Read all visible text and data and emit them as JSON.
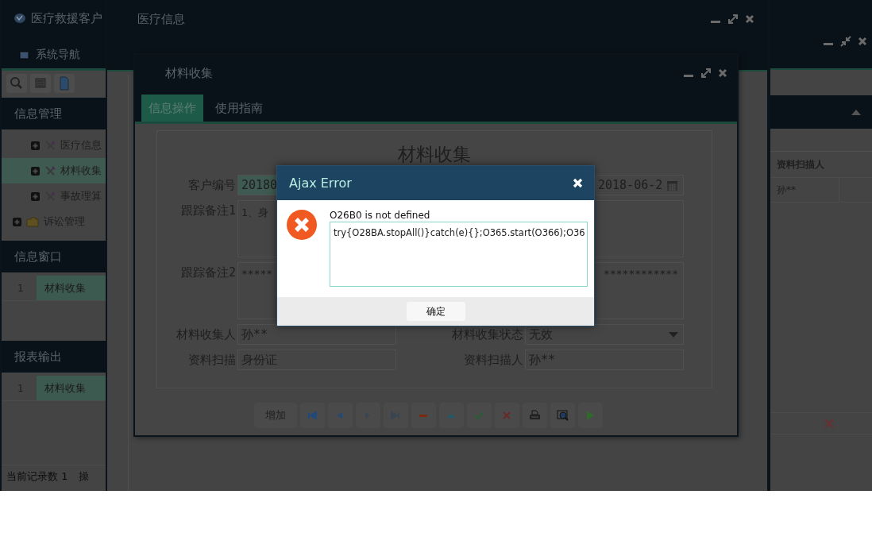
{
  "main_window": {
    "title": "医疗救援客户",
    "tabs": [
      {
        "label": "系统导航",
        "selected": false
      }
    ],
    "sections": [
      {
        "title": "信息管理",
        "tree": [
          {
            "label": "医疗信息",
            "kind": "module",
            "expanded": false,
            "selected": false
          },
          {
            "label": "材料收集",
            "kind": "module",
            "expanded": false,
            "selected": true
          },
          {
            "label": "事故理算",
            "kind": "module",
            "expanded": false,
            "selected": false
          }
        ],
        "folders": [
          {
            "label": "诉讼管理",
            "kind": "folder",
            "expanded": false,
            "selected": false
          }
        ]
      },
      {
        "title": "信息窗口",
        "rows": [
          {
            "index": "1",
            "label": "材料收集"
          }
        ]
      },
      {
        "title": "报表输出",
        "rows": [
          {
            "index": "1",
            "label": "材料收集"
          }
        ]
      }
    ],
    "status_bar": {
      "record_count": "当前记录数 1",
      "operation": "操"
    },
    "grid": {
      "columns": [
        "资料扫描人"
      ],
      "rows": [
        [
          "孙**"
        ]
      ]
    }
  },
  "info_window": {
    "title": "医疗信息"
  },
  "form_window": {
    "title": "材料收集",
    "tabs": [
      {
        "label": "信息操作",
        "selected": true
      },
      {
        "label": "使用指南",
        "selected": false
      }
    ],
    "form": {
      "heading": "材料收集",
      "rows": [
        {
          "cells": [
            {
              "label": "客户编号",
              "value": "20180",
              "kind": "text"
            },
            {
              "value": "2018-06-2",
              "kind": "date"
            }
          ]
        },
        {
          "cells": [
            {
              "label": "跟踪备注1",
              "value": "1、身",
              "kind": "textarea"
            }
          ]
        },
        {
          "cells": [
            {
              "label": "跟踪备注2",
              "value": "*****",
              "value_right": "************",
              "kind": "textarea"
            }
          ]
        },
        {
          "cells": [
            {
              "label": "材料收集人",
              "value": "孙**",
              "kind": "text"
            },
            {
              "label": "材料收集状态",
              "value": "无效",
              "kind": "select"
            }
          ]
        },
        {
          "cells": [
            {
              "label": "资料扫描",
              "value": "身份证",
              "kind": "text"
            },
            {
              "label": "资料扫描人",
              "value": "孙**",
              "kind": "text"
            }
          ]
        }
      ]
    },
    "toolbar": {
      "add_label": "增加",
      "buttons": [
        {
          "kind": "first",
          "disabled": false
        },
        {
          "kind": "prev",
          "disabled": false
        },
        {
          "kind": "next",
          "disabled": true
        },
        {
          "kind": "last",
          "disabled": true
        },
        {
          "kind": "delete",
          "disabled": false
        },
        {
          "kind": "up",
          "disabled": false
        },
        {
          "kind": "save",
          "disabled": false
        },
        {
          "kind": "cancel",
          "disabled": false
        },
        {
          "kind": "print",
          "disabled": false
        },
        {
          "kind": "preview",
          "disabled": false
        },
        {
          "kind": "run",
          "disabled": false
        }
      ]
    }
  },
  "dialog": {
    "title": "Ajax Error",
    "message": "O26B0 is not defined",
    "detail": "try{O28BA.stopAll()}catch(e){};O365.start(O366);O36",
    "buttons": [
      "确定"
    ]
  }
}
